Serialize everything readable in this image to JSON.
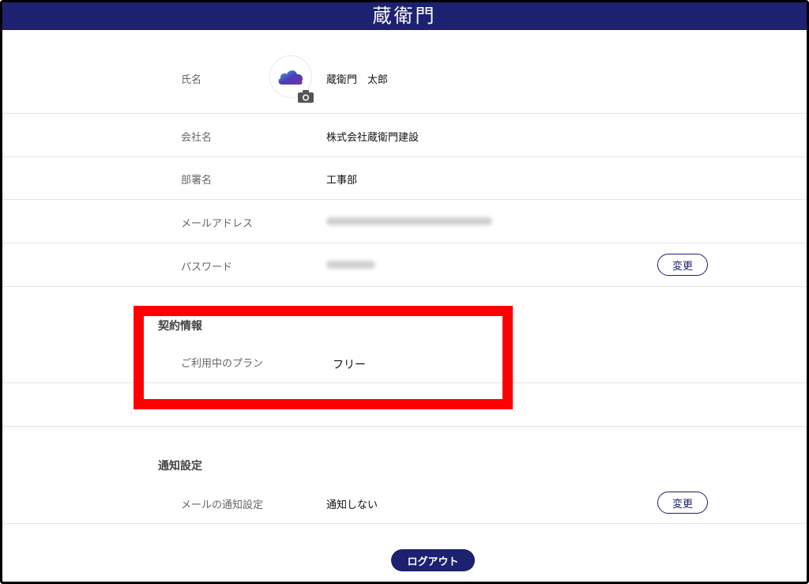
{
  "header": {
    "logo_text": "蔵衛門"
  },
  "profile": {
    "name": {
      "label": "氏名",
      "value": "蔵衛門　太郎"
    },
    "company": {
      "label": "会社名",
      "value": "株式会社蔵衛門建設"
    },
    "department": {
      "label": "部署名",
      "value": "工事部"
    },
    "email": {
      "label": "メールアドレス"
    },
    "password": {
      "label": "パスワード",
      "change_label": "変更"
    }
  },
  "contract": {
    "title": "契約情報",
    "plan": {
      "label": "ご利用中のプラン",
      "value": "フリー"
    }
  },
  "notification": {
    "title": "通知設定",
    "email_setting": {
      "label": "メールの通知設定",
      "value": "通知しない",
      "change_label": "変更"
    }
  },
  "logout_label": "ログアウト",
  "colors": {
    "brand_navy": "#1c2170",
    "highlight_red": "#ff0000"
  },
  "icons": [
    "cloud-logo-icon",
    "camera-icon"
  ]
}
